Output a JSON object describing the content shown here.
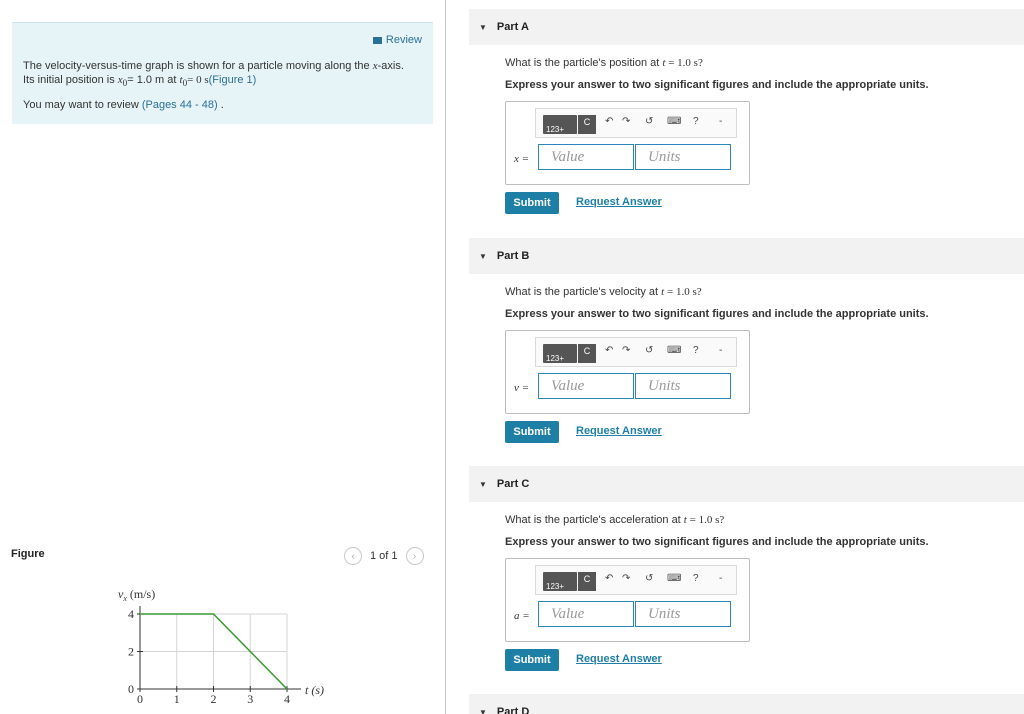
{
  "review": {
    "label": "Review"
  },
  "problem": {
    "text1": "The velocity-versus-time graph is shown for a particle moving along the ",
    "x_axis_var": "x",
    "text2": "-axis. Its initial position is ",
    "x0": "x",
    "x0_sub": "0",
    "x0_value": "= 1.0 m at ",
    "t0": "t",
    "t0_sub": "0",
    "t0_value": "= 0 s",
    "figure_link": "(Figure 1)",
    "review_text": "You may want to review ",
    "pages_link": "(Pages 44 - 48)",
    "review_end": " ."
  },
  "figure": {
    "label": "Figure",
    "pager": "1 of 1",
    "prev_icon": "chevron-left-icon",
    "next_icon": "chevron-right-icon"
  },
  "chart_data": {
    "type": "line",
    "ylabel_var": "v",
    "ylabel_sub": "x",
    "ylabel_unit": " (m/s)",
    "xlabel": "t (s)",
    "x_ticks": [
      "0",
      "1",
      "2",
      "3",
      "4"
    ],
    "y_ticks": [
      "0",
      "2",
      "4"
    ],
    "xlim": [
      0,
      4
    ],
    "ylim": [
      0,
      4
    ],
    "grid": true,
    "series": [
      {
        "color": "#3a9a2e",
        "x": [
          0,
          2,
          4
        ],
        "y": [
          4,
          4,
          0
        ]
      }
    ]
  },
  "parts": [
    {
      "title": "Part A",
      "question_pre": "What is the particle's position at ",
      "question_var": "t",
      "question_val": " = 1.0 s",
      "question_end": "?",
      "instruction": "Express your answer to two significant figures and include the appropriate units.",
      "variable": "x =",
      "value_placeholder": "Value",
      "units_placeholder": "Units",
      "submit": "Submit",
      "request": "Request Answer"
    },
    {
      "title": "Part B",
      "question_pre": "What is the particle's velocity at ",
      "question_var": "t",
      "question_val": " = 1.0 s",
      "question_end": "?",
      "instruction": "Express your answer to two significant figures and include the appropriate units.",
      "variable": "v =",
      "value_placeholder": "Value",
      "units_placeholder": "Units",
      "submit": "Submit",
      "request": "Request Answer"
    },
    {
      "title": "Part C",
      "question_pre": "What is the particle's acceleration at ",
      "question_var": "t",
      "question_val": " = 1.0 s",
      "question_end": "?",
      "instruction": "Express your answer to two significant figures and include the appropriate units.",
      "variable": "a =",
      "value_placeholder": "Value",
      "units_placeholder": "Units",
      "submit": "Submit",
      "request": "Request Answer"
    },
    {
      "title": "Part D"
    }
  ],
  "toolbar": {
    "template_label": "123+",
    "units_label": "C",
    "undo": "↶",
    "redo": "↷",
    "reset": "↺",
    "keyboard": "⌨",
    "help": "?",
    "minus": "-"
  }
}
